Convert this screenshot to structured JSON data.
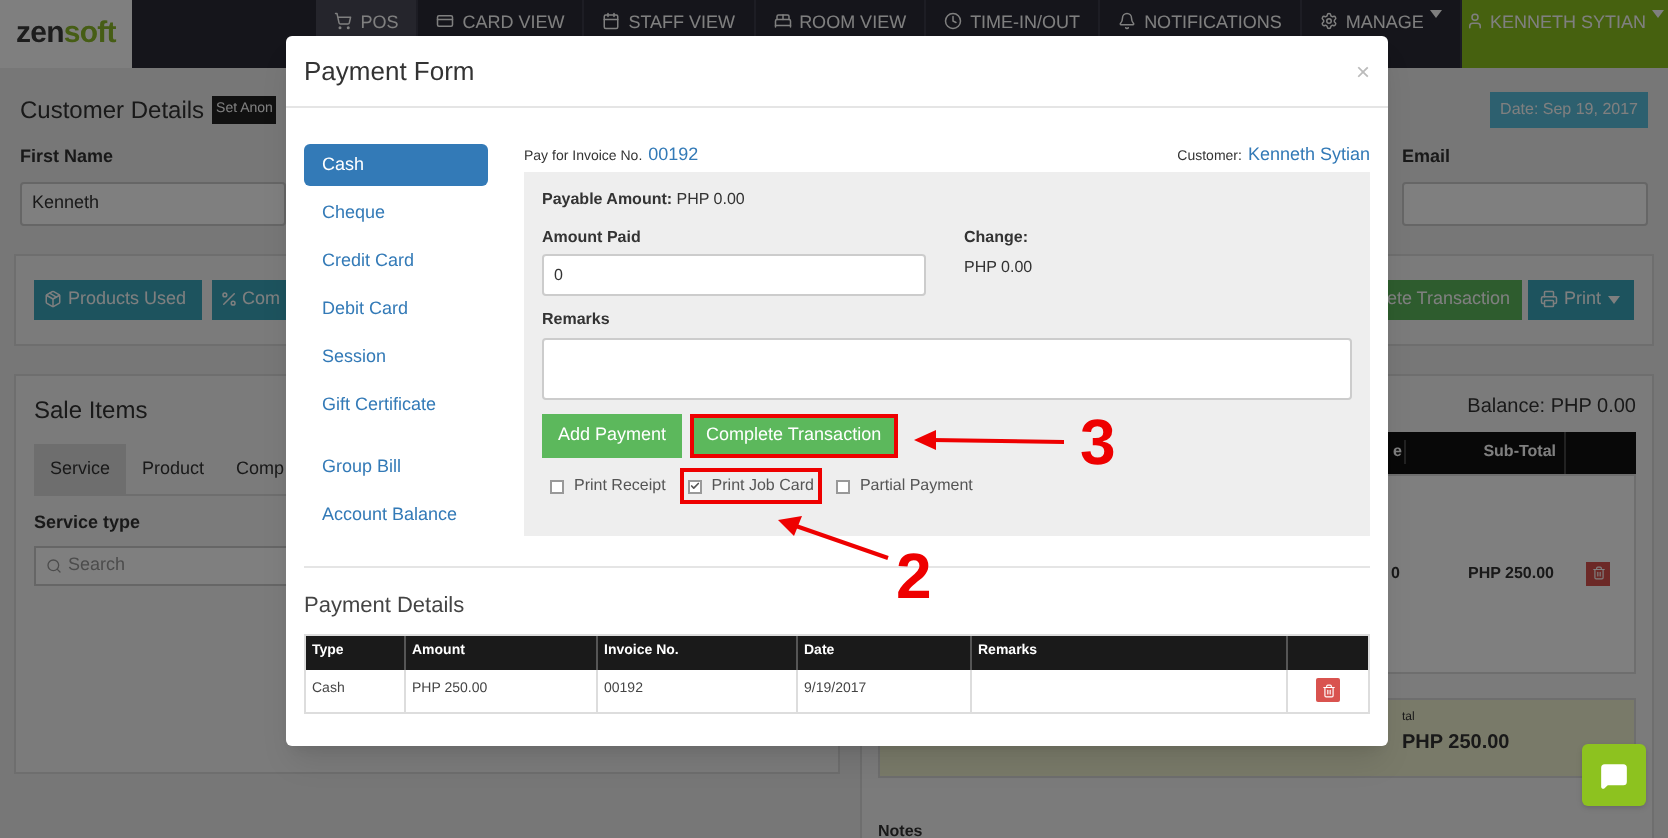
{
  "navbar": {
    "logo": {
      "first": "zen",
      "second": "soft"
    },
    "items": [
      {
        "label": "POS",
        "selected": true,
        "dropdown": false
      },
      {
        "label": "CARD VIEW",
        "selected": false,
        "dropdown": false
      },
      {
        "label": "STAFF VIEW",
        "selected": false,
        "dropdown": false
      },
      {
        "label": "ROOM VIEW",
        "selected": false,
        "dropdown": false
      },
      {
        "label": "TIME-IN/OUT",
        "selected": false,
        "dropdown": false
      },
      {
        "label": "NOTIFICATIONS",
        "selected": false,
        "dropdown": false
      },
      {
        "label": "MANAGE",
        "selected": false,
        "dropdown": true
      }
    ],
    "user": "KENNETH SYTIAN"
  },
  "customer_details": {
    "title": "Customer Details",
    "anonymous_button": "Set Anon",
    "date": "Date: Sep 19, 2017",
    "first_name": {
      "label": "First Name",
      "value": "Kenneth"
    },
    "email": {
      "label": "Email"
    }
  },
  "action_bar": {
    "products_used": "Products Used",
    "commission": "Com",
    "complete": "ete Transaction",
    "print": "Print"
  },
  "sale_items": {
    "title": "Sale Items",
    "tabs": [
      {
        "label": "Service",
        "selected": true
      },
      {
        "label": "Product",
        "selected": false
      },
      {
        "label": "Comp",
        "selected": false
      }
    ],
    "service_type": {
      "label": "Service type",
      "placeholder": "Search"
    }
  },
  "summary": {
    "balance": "Balance: PHP 0.00",
    "table": {
      "columns": [
        "e",
        "Sub-Total"
      ],
      "rows": [
        {
          "cells": [
            "0",
            "PHP 250.00"
          ]
        }
      ]
    },
    "totals": {
      "label": "tal",
      "value": "PHP 250.00"
    },
    "notes_label": "Notes"
  },
  "modal": {
    "title": "Payment Form",
    "close": "×",
    "methods": [
      {
        "label": "Cash",
        "selected": true
      },
      {
        "label": "Cheque",
        "selected": false
      },
      {
        "label": "Credit Card",
        "selected": false
      },
      {
        "label": "Debit Card",
        "selected": false
      },
      {
        "label": "Session",
        "selected": false
      },
      {
        "label": "Gift Certificate",
        "selected": false
      }
    ],
    "other_methods": [
      {
        "label": "Group Bill",
        "selected": false
      },
      {
        "label": "Account Balance",
        "selected": false
      }
    ],
    "invoice_label": "Pay for Invoice No.",
    "invoice_no": "00192",
    "customer_label": "Customer:",
    "customer": "Kenneth Sytian",
    "payable_label": "Payable Amount:",
    "payable": "PHP 0.00",
    "amount_paid": {
      "label": "Amount Paid",
      "value": "0"
    },
    "change": {
      "label": "Change:",
      "value": "PHP 0.00"
    },
    "remarks": {
      "label": "Remarks"
    },
    "buttons": [
      {
        "label": "Add Payment",
        "highlighted": false
      },
      {
        "label": "Complete Transaction",
        "highlighted": true
      }
    ],
    "options": [
      {
        "label": "Print Receipt",
        "checked": false,
        "highlighted": false
      },
      {
        "label": "Print Job Card",
        "checked": true,
        "highlighted": true
      },
      {
        "label": "Partial Payment",
        "checked": false,
        "highlighted": false
      }
    ],
    "payment_details": {
      "title": "Payment Details",
      "columns": [
        "Type",
        "Amount",
        "Invoice No.",
        "Date",
        "Remarks"
      ],
      "rows": [
        {
          "cells": [
            "Cash",
            "PHP 250.00",
            "00192",
            "9/19/2017"
          ]
        }
      ]
    }
  },
  "annotations": [
    {
      "label": "3"
    },
    {
      "label": "2"
    }
  ]
}
